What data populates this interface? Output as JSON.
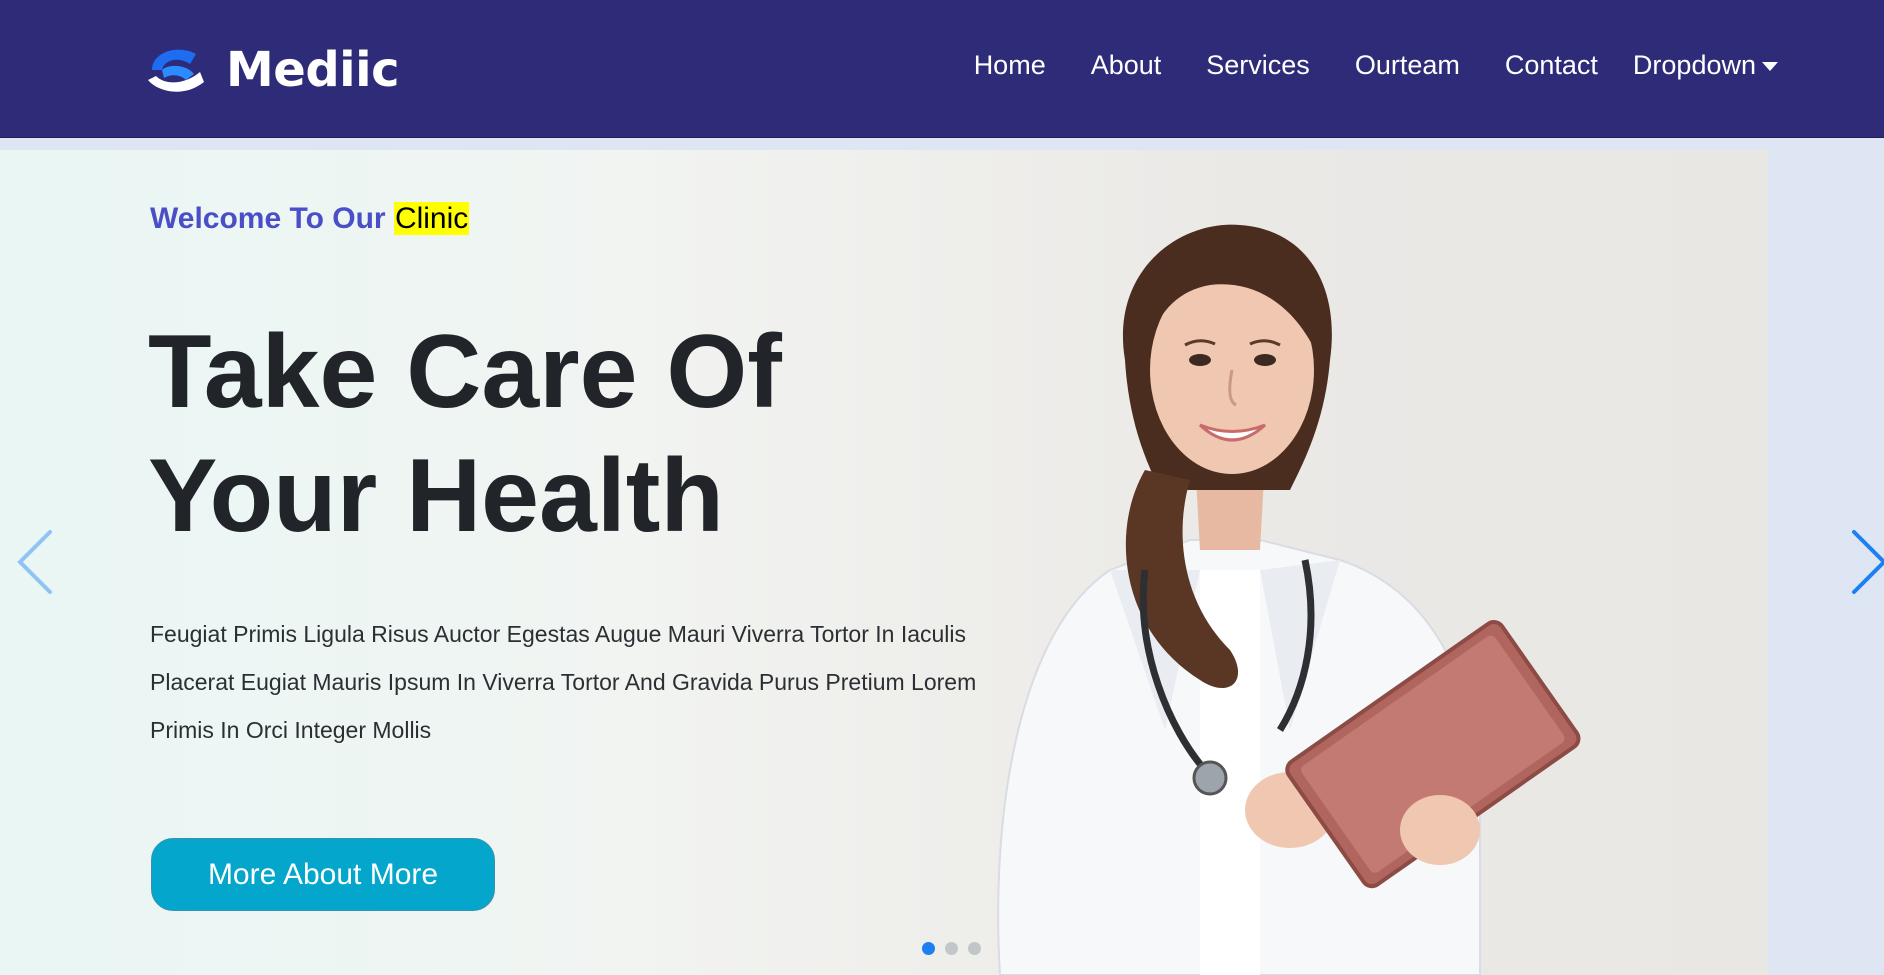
{
  "brand": {
    "name": "Mediic",
    "logo_icon": "mediic-logo-icon"
  },
  "nav": {
    "items": [
      {
        "label": "Home"
      },
      {
        "label": "About"
      },
      {
        "label": "Services"
      },
      {
        "label": "Ourteam"
      },
      {
        "label": "Contact"
      }
    ],
    "dropdown_label": "Dropdown"
  },
  "hero": {
    "welcome_prefix": "Welcome To Our",
    "welcome_highlight": "Clinic",
    "headline_line1": "Take Care Of",
    "headline_line2": "Your Health",
    "description_line1": "Feugiat Primis Ligula Risus Auctor Egestas Augue Mauri Viverra Tortor In Iaculis",
    "description_line2": "Placerat Eugiat Mauris Ipsum In Viverra Tortor And Gravida Purus Pretium Lorem",
    "description_line3": "Primis In Orci Integer Mollis",
    "cta_label": "More About More",
    "image": "doctor-with-tablet-photo"
  },
  "carousel": {
    "slide_count": 3,
    "active_slide": 1,
    "prev_icon": "chevron-left-icon",
    "next_icon": "chevron-right-icon"
  },
  "colors": {
    "navbar_bg": "#2e2b78",
    "accent_blue": "#4a4fc8",
    "highlight": "#ffff00",
    "cta_bg": "#04a6cc",
    "indicator_active": "#1e7ff0"
  }
}
